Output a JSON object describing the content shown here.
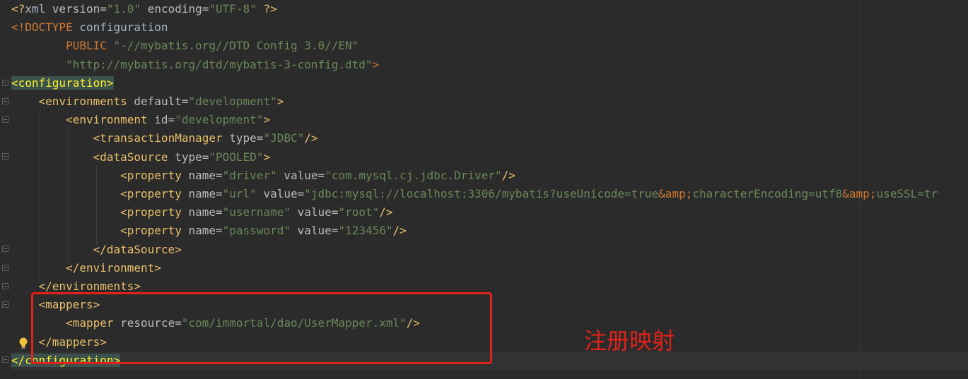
{
  "lines": [
    {
      "segments": [
        {
          "t": "<?",
          "c": "t-punc"
        },
        {
          "t": "xml ",
          "c": "t-doc"
        },
        {
          "t": "version",
          "c": "t-attr"
        },
        {
          "t": "=",
          "c": "t-attr"
        },
        {
          "t": "\"1.0\"",
          "c": "t-val"
        },
        {
          "t": " ",
          "c": "t-doc"
        },
        {
          "t": "encoding",
          "c": "t-attr"
        },
        {
          "t": "=",
          "c": "t-attr"
        },
        {
          "t": "\"UTF-8\"",
          "c": "t-val"
        },
        {
          "t": " ",
          "c": "t-doc"
        },
        {
          "t": "?>",
          "c": "t-punc"
        }
      ]
    },
    {
      "segments": [
        {
          "t": "<!DOCTYPE ",
          "c": "t-kw"
        },
        {
          "t": "configuration",
          "c": "t-doc"
        }
      ]
    },
    {
      "segments": [
        {
          "t": "        ",
          "c": "t-doc"
        },
        {
          "t": "PUBLIC ",
          "c": "t-kw"
        },
        {
          "t": "\"-//mybatis.org//DTD Config 3.0//EN\"",
          "c": "t-val"
        }
      ]
    },
    {
      "segments": [
        {
          "t": "        ",
          "c": "t-doc"
        },
        {
          "t": "\"http://mybatis.org/dtd/mybatis-3-config.dtd\"",
          "c": "t-val"
        },
        {
          "t": ">",
          "c": "t-kw"
        }
      ]
    },
    {
      "segments": [
        {
          "t": "<configuration>",
          "c": "hl-tag"
        }
      ]
    },
    {
      "segments": [
        {
          "t": "    ",
          "c": "t-doc"
        },
        {
          "t": "<",
          "c": "t-br"
        },
        {
          "t": "environments ",
          "c": "t-tagb"
        },
        {
          "t": "default",
          "c": "t-attr"
        },
        {
          "t": "=",
          "c": "t-attr"
        },
        {
          "t": "\"development\"",
          "c": "t-val"
        },
        {
          "t": ">",
          "c": "t-br"
        }
      ]
    },
    {
      "segments": [
        {
          "t": "        ",
          "c": "t-doc"
        },
        {
          "t": "<",
          "c": "t-br"
        },
        {
          "t": "environment ",
          "c": "t-tagb"
        },
        {
          "t": "id",
          "c": "t-attr"
        },
        {
          "t": "=",
          "c": "t-attr"
        },
        {
          "t": "\"development\"",
          "c": "t-val"
        },
        {
          "t": ">",
          "c": "t-br"
        }
      ]
    },
    {
      "segments": [
        {
          "t": "            ",
          "c": "t-doc"
        },
        {
          "t": "<",
          "c": "t-br"
        },
        {
          "t": "transactionManager ",
          "c": "t-tagb"
        },
        {
          "t": "type",
          "c": "t-attr"
        },
        {
          "t": "=",
          "c": "t-attr"
        },
        {
          "t": "\"JDBC\"",
          "c": "t-val"
        },
        {
          "t": "/>",
          "c": "t-br"
        }
      ]
    },
    {
      "segments": [
        {
          "t": "            ",
          "c": "t-doc"
        },
        {
          "t": "<",
          "c": "t-br"
        },
        {
          "t": "dataSource ",
          "c": "t-tagb"
        },
        {
          "t": "type",
          "c": "t-attr"
        },
        {
          "t": "=",
          "c": "t-attr"
        },
        {
          "t": "\"POOLED\"",
          "c": "t-val"
        },
        {
          "t": ">",
          "c": "t-br"
        }
      ]
    },
    {
      "segments": [
        {
          "t": "                ",
          "c": "t-doc"
        },
        {
          "t": "<",
          "c": "t-br"
        },
        {
          "t": "property ",
          "c": "t-tagb"
        },
        {
          "t": "name",
          "c": "t-attr"
        },
        {
          "t": "=",
          "c": "t-attr"
        },
        {
          "t": "\"driver\"",
          "c": "t-val"
        },
        {
          "t": " ",
          "c": "t-doc"
        },
        {
          "t": "value",
          "c": "t-attr"
        },
        {
          "t": "=",
          "c": "t-attr"
        },
        {
          "t": "\"com.mysql.cj.jdbc.Driver\"",
          "c": "t-val"
        },
        {
          "t": "/>",
          "c": "t-br"
        }
      ]
    },
    {
      "segments": [
        {
          "t": "                ",
          "c": "t-doc"
        },
        {
          "t": "<",
          "c": "t-br"
        },
        {
          "t": "property ",
          "c": "t-tagb"
        },
        {
          "t": "name",
          "c": "t-attr"
        },
        {
          "t": "=",
          "c": "t-attr"
        },
        {
          "t": "\"url\"",
          "c": "t-val"
        },
        {
          "t": " ",
          "c": "t-doc"
        },
        {
          "t": "value",
          "c": "t-attr"
        },
        {
          "t": "=",
          "c": "t-attr"
        },
        {
          "t": "\"jdbc:mysql://localhost:3306/mybatis?useUnicode=true",
          "c": "t-val"
        },
        {
          "t": "&amp;",
          "c": "t-ent"
        },
        {
          "t": "characterEncoding=utf8",
          "c": "t-val"
        },
        {
          "t": "&amp;",
          "c": "t-ent"
        },
        {
          "t": "useSSL=tr",
          "c": "t-val"
        }
      ]
    },
    {
      "segments": [
        {
          "t": "                ",
          "c": "t-doc"
        },
        {
          "t": "<",
          "c": "t-br"
        },
        {
          "t": "property ",
          "c": "t-tagb"
        },
        {
          "t": "name",
          "c": "t-attr"
        },
        {
          "t": "=",
          "c": "t-attr"
        },
        {
          "t": "\"username\"",
          "c": "t-val"
        },
        {
          "t": " ",
          "c": "t-doc"
        },
        {
          "t": "value",
          "c": "t-attr"
        },
        {
          "t": "=",
          "c": "t-attr"
        },
        {
          "t": "\"root\"",
          "c": "t-val"
        },
        {
          "t": "/>",
          "c": "t-br"
        }
      ]
    },
    {
      "segments": [
        {
          "t": "                ",
          "c": "t-doc"
        },
        {
          "t": "<",
          "c": "t-br"
        },
        {
          "t": "property ",
          "c": "t-tagb"
        },
        {
          "t": "name",
          "c": "t-attr"
        },
        {
          "t": "=",
          "c": "t-attr"
        },
        {
          "t": "\"password\"",
          "c": "t-val"
        },
        {
          "t": " ",
          "c": "t-doc"
        },
        {
          "t": "value",
          "c": "t-attr"
        },
        {
          "t": "=",
          "c": "t-attr"
        },
        {
          "t": "\"123456\"",
          "c": "t-val"
        },
        {
          "t": "/>",
          "c": "t-br"
        }
      ]
    },
    {
      "segments": [
        {
          "t": "            ",
          "c": "t-doc"
        },
        {
          "t": "</",
          "c": "t-br"
        },
        {
          "t": "dataSource",
          "c": "t-tagb"
        },
        {
          "t": ">",
          "c": "t-br"
        }
      ]
    },
    {
      "segments": [
        {
          "t": "        ",
          "c": "t-doc"
        },
        {
          "t": "</",
          "c": "t-br"
        },
        {
          "t": "environment",
          "c": "t-tagb"
        },
        {
          "t": ">",
          "c": "t-br"
        }
      ]
    },
    {
      "segments": [
        {
          "t": "    ",
          "c": "t-doc"
        },
        {
          "t": "</",
          "c": "t-br"
        },
        {
          "t": "environments",
          "c": "t-tagb"
        },
        {
          "t": ">",
          "c": "t-br"
        }
      ]
    },
    {
      "segments": [
        {
          "t": "    ",
          "c": "t-doc"
        },
        {
          "t": "<",
          "c": "t-br"
        },
        {
          "t": "mappers",
          "c": "t-tagb"
        },
        {
          "t": ">",
          "c": "t-br"
        }
      ]
    },
    {
      "segments": [
        {
          "t": "        ",
          "c": "t-doc"
        },
        {
          "t": "<",
          "c": "t-br"
        },
        {
          "t": "mapper ",
          "c": "t-tagb"
        },
        {
          "t": "resource",
          "c": "t-attr"
        },
        {
          "t": "=",
          "c": "t-attr"
        },
        {
          "t": "\"com/immortal/dao/UserMapper.xml\"",
          "c": "t-val"
        },
        {
          "t": "/>",
          "c": "t-br"
        }
      ]
    },
    {
      "segments": [
        {
          "t": "    ",
          "c": "t-doc"
        },
        {
          "t": "</",
          "c": "t-br"
        },
        {
          "t": "mappers",
          "c": "t-tagb"
        },
        {
          "t": ">",
          "c": "t-br"
        }
      ]
    },
    {
      "segments": [
        {
          "t": "</configuration>",
          "c": "hl-tag"
        }
      ]
    }
  ],
  "annotation": {
    "text": "注册映射",
    "color": "#e0221a"
  },
  "colors": {
    "background": "#2b2b2b",
    "tag": "#e8bf6a",
    "value": "#6a8759",
    "keyword": "#cc7832",
    "highlight": "#3b514d"
  },
  "icons": {
    "intention": "lightbulb-icon",
    "fold": "fold-marker-icon"
  }
}
